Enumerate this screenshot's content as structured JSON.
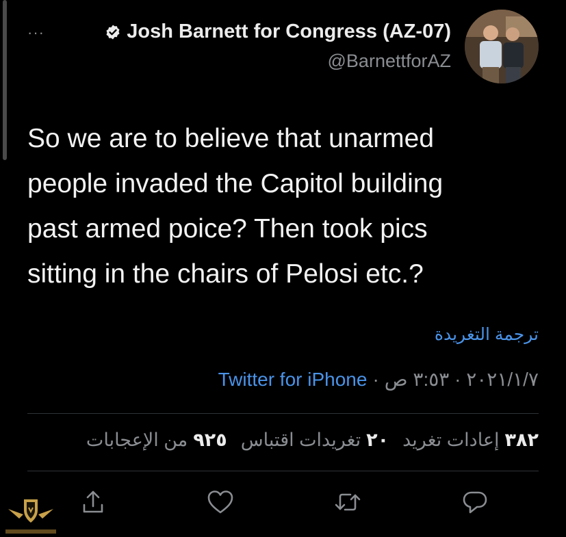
{
  "header": {
    "more_label": "···",
    "display_name": "Josh Barnett for Congress (AZ-07)",
    "handle": "@BarnettforAZ"
  },
  "tweet": {
    "line1": "So we are to believe that unarmed",
    "line2": "people invaded the Capitol building",
    "line3": "past armed poice? Then took pics",
    "line4": "sitting in the chairs of Pelosi etc.?",
    "translate_label": "ترجمة التغريدة"
  },
  "meta": {
    "date_time": "٢٠٢١/١/٧ · ٣:٥٣ ص",
    "separator": "·",
    "source": "Twitter for iPhone"
  },
  "stats": {
    "retweets_count": "٣٨٢",
    "retweets_label": "إعادات تغريد",
    "quotes_count": "٢٠",
    "quotes_label": "تغريدات اقتباس",
    "likes_count": "٩٢٥",
    "likes_label": "من الإعجابات"
  },
  "actions": {
    "reply_icon": "reply-icon",
    "retweet_icon": "retweet-icon",
    "like_icon": "heart-icon",
    "share_icon": "share-icon"
  },
  "colors": {
    "background": "#000000",
    "link_blue": "#4a93e8",
    "muted_gray": "#8a8d91",
    "text_white": "#f2f2f2"
  }
}
